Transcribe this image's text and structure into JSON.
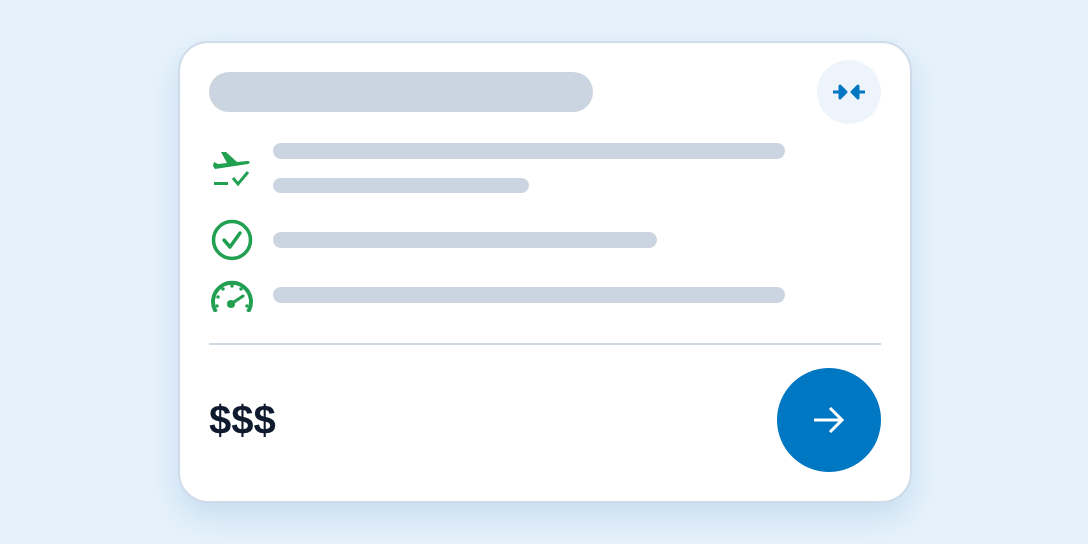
{
  "price": "$$$"
}
